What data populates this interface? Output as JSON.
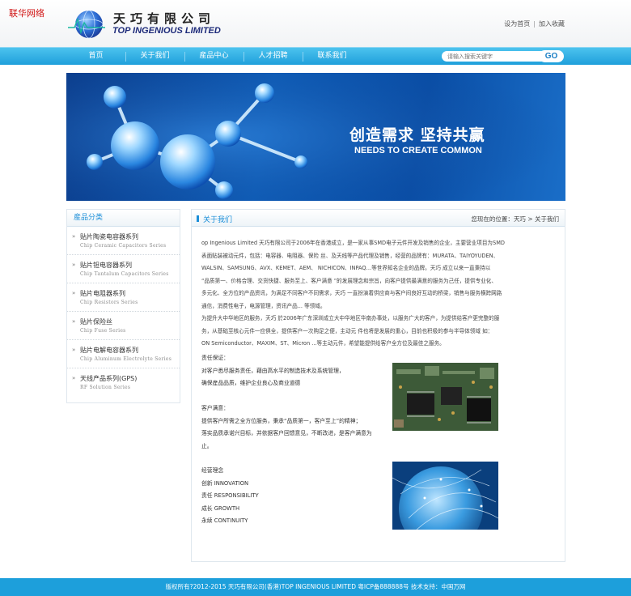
{
  "watermark": "联华网络",
  "header": {
    "company_cn": "天巧有限公司",
    "company_en": "TOP INGENIOUS LIMITED",
    "links": [
      "设为首页",
      "加入收藏"
    ]
  },
  "nav": {
    "items": [
      "首页",
      "关于我们",
      "産品中心",
      "人才招聘",
      "联系我们"
    ],
    "search_placeholder": "请输入搜索关键字",
    "search_button": "GO"
  },
  "banner": {
    "slogan": "创造需求 坚持共赢",
    "subtitle": "NEEDS TO CREATE COMMON"
  },
  "sidebar": {
    "title": "産品分类",
    "items": [
      {
        "cn": "贴片陶瓷电容器系列",
        "en": "Chip Ceramic Capacitors Series"
      },
      {
        "cn": "贴片钽电容器系列",
        "en": "Chip Tantalum Capacitors Series"
      },
      {
        "cn": "贴片电阻器系列",
        "en": "Chip Resistors Series"
      },
      {
        "cn": "贴片保险丝",
        "en": "Chip Fuse Series"
      },
      {
        "cn": "贴片电解电容器系列",
        "en": "Chip Aluminum Electrolyte Series"
      },
      {
        "cn": "天线产品系列(GPS)",
        "en": "RF Solution Series"
      }
    ]
  },
  "main": {
    "title": "关于我们",
    "breadcrumb_prefix": "您现在的位置：",
    "breadcrumb_home": "天巧",
    "breadcrumb_sep": " > ",
    "breadcrumb_current": "关于我们",
    "intro": [
      "op Ingenious Limited 天巧有限公司于2006年在香港成立，是一家从事SMD电子元件开发及销售的企业，主要营业项目为SMD",
      "表面贴装被动元件，包括：电容器、电阻器、保险 丝、及天线等产品代理及销售，经营的品牌有：MURATA、TAIYOYUDEN、",
      "WALSIN、SAMSUNG、AVX、KEMET、AEM、 NICHICON、INPAQ…等世界知名企业的品牌。天巧 成立以来一直秉持以",
      "“品质第一、价格合理、交货快捷、服务至上、客户满意 ”的发展理念和宗旨，向客户提供最满意的服务为己任，提供专业化、",
      "多元化、全方位的产品资讯，为满足不同客户不同需求，天巧 一直扮演着供应商与客户间良好互动的桥梁，销售与服务横跨网路",
      "通信，消费性电子，电源管理，资讯产品... 等领域。",
      "为提升大中华地区的服务，天巧 於2006年广东深圳成立大中华地区华南办事处，以服务广大的客户，为提供给客户更完整的服",
      "务，从基础至核心元件一应俱全，提供客户一次购足之便，主动元 件也将是发展的重心，目前也积极的参与半导体领域 如：",
      "ON Semiconductor、MAXIM、ST、Micron ...等主动元件，希望能提供给客户全方位及最佳之服务。"
    ],
    "responsibility": {
      "heading": "责任保证：",
      "lines": [
        "对客户悉尽服务责任，藉由高水平的制造技术及系统管理，",
        "确保産品品质，维护企业良心及商业道德"
      ]
    },
    "satisfaction": {
      "heading": "客户满意：",
      "lines": [
        "提供客户所需之全方位服务，秉承“品质第一，客户至上”的精神；",
        "落实品质承诺兴目标，并依据客户回馈意见，不断改进，是客户满意为",
        "止。"
      ]
    },
    "philosophy": {
      "heading": "经营理念",
      "lines": [
        "创新 INNOVATION",
        "责任 RESPONSIBILITY",
        "成长 GROWTH",
        "永续 CONTINUITY"
      ]
    }
  },
  "footer": {
    "text": "版权所有?2012-2015 天巧有限公司(香港)TOP INGENIOUS LIMITED 粤ICP备888888号 技术支持：中国万网"
  }
}
